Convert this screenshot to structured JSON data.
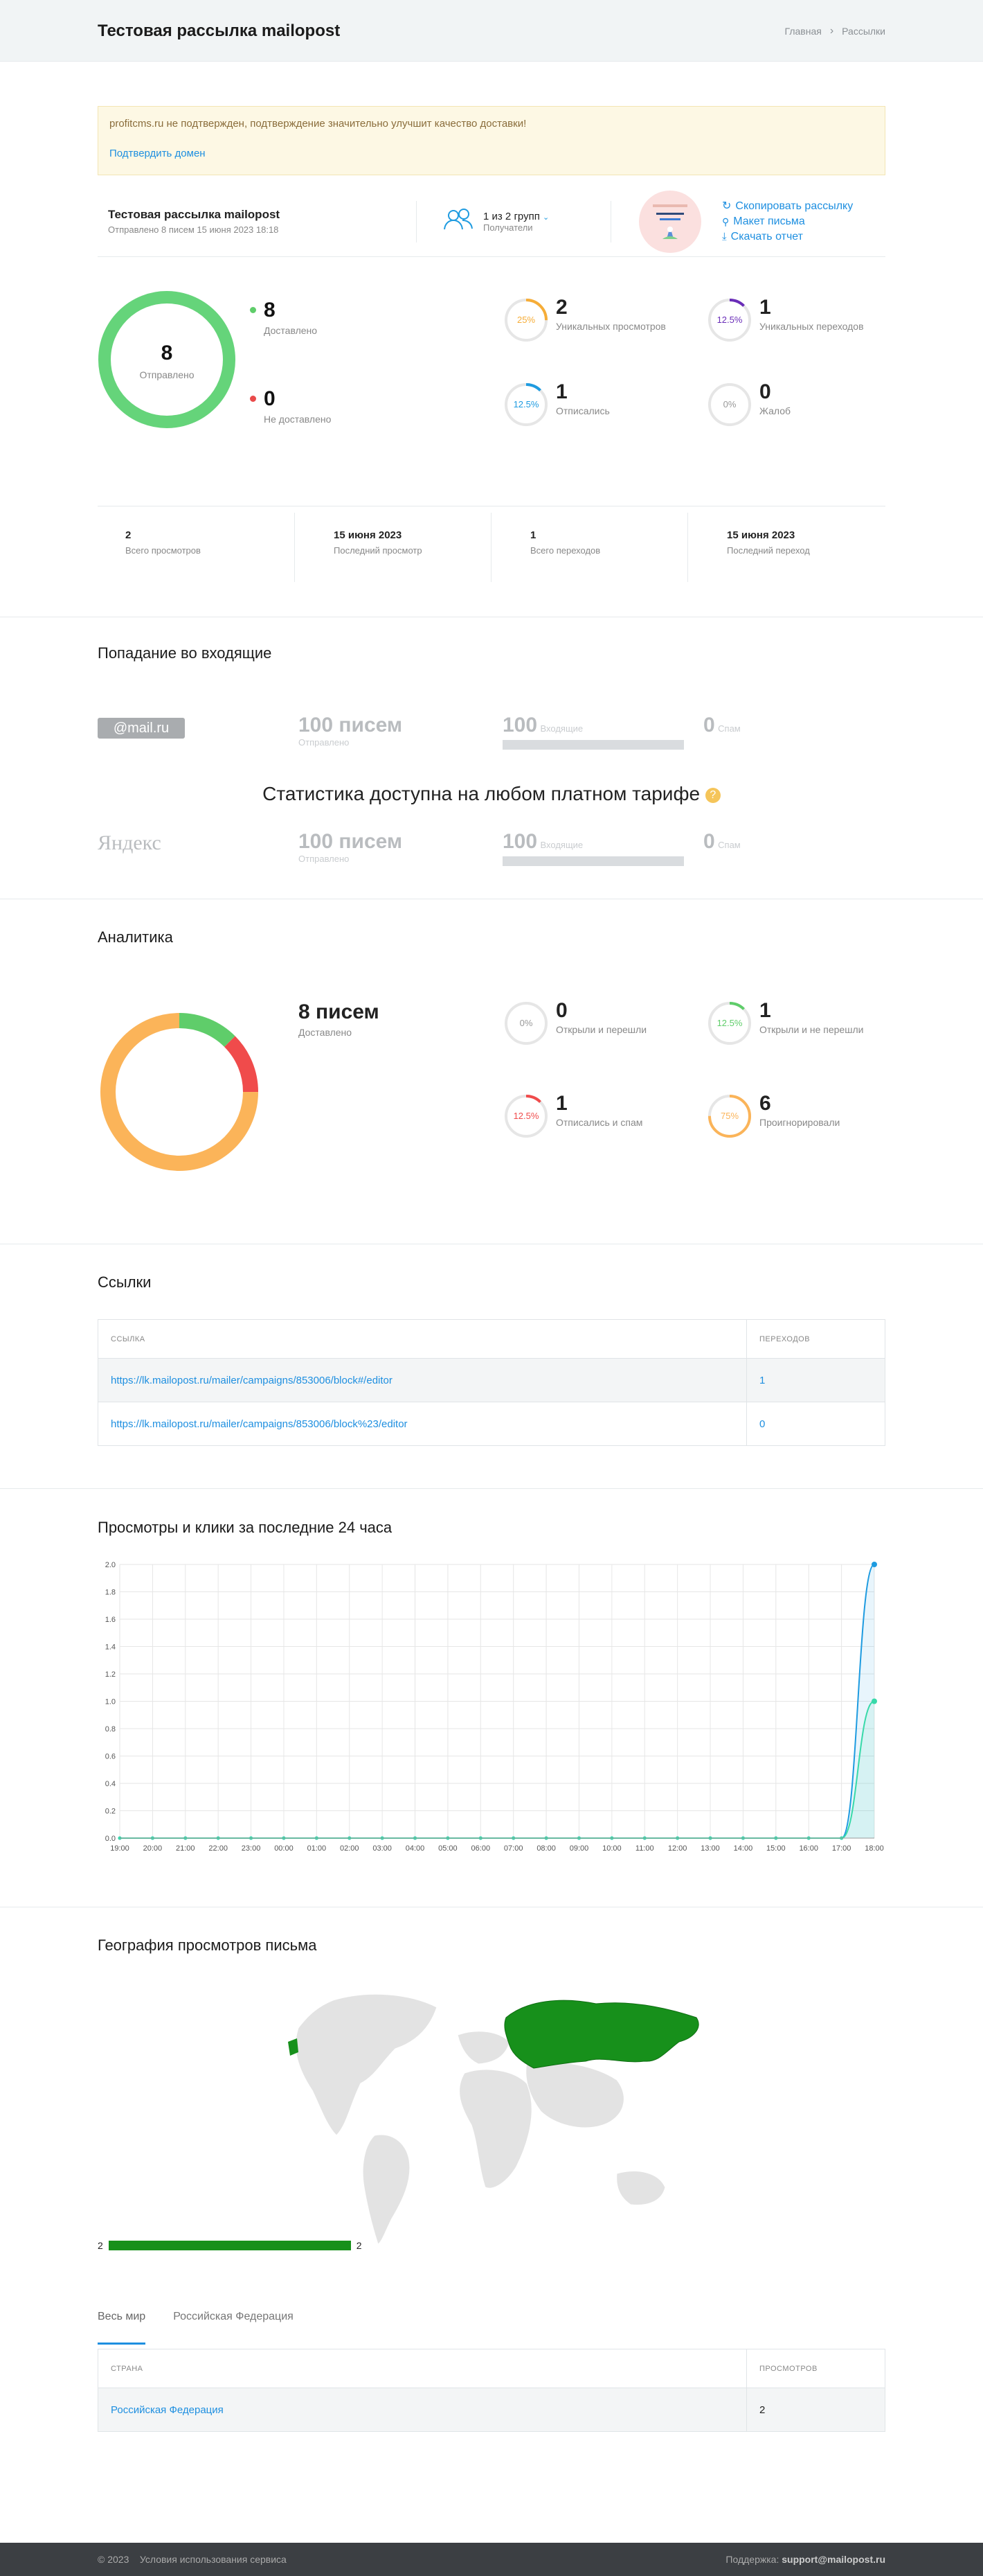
{
  "header": {
    "title": "Тестовая рассылка mailopost",
    "breadcrumbs": [
      "Главная",
      "Рассылки"
    ]
  },
  "alert": {
    "message": "profitcms.ru не подтвержден, подтверждение значительно улучшит качество доставки!",
    "link": "Подтвердить домен"
  },
  "campaign": {
    "name": "Тестовая рассылка mailopost",
    "sent_info": "Отправлено 8 писем 15 июня 2023 18:18",
    "recipients": "1 из 2 групп",
    "recipients_label": "Получатели",
    "actions": [
      "Скопировать рассылку",
      "Макет письма",
      "Скачать отчет"
    ]
  },
  "delivery": {
    "sent": "8",
    "sent_label": "Отправлено",
    "delivered": "8",
    "delivered_label": "Доставлено",
    "not_delivered": "0",
    "not_delivered_label": "Не доставлено",
    "delivered_fraction": 1.0
  },
  "metrics": [
    {
      "pct": "25%",
      "fraction": 0.25,
      "color": "#f6ad38",
      "value": "2",
      "label": "Уникальных просмотров"
    },
    {
      "pct": "12.5%",
      "fraction": 0.125,
      "color": "#6a2db8",
      "value": "1",
      "label": "Уникальных переходов"
    },
    {
      "pct": "12.5%",
      "fraction": 0.125,
      "color": "#1e9be0",
      "value": "1",
      "label": "Отписались"
    },
    {
      "pct": "0%",
      "fraction": 0,
      "color": "#e94a4a",
      "value": "0",
      "label": "Жалоб"
    }
  ],
  "totals": [
    {
      "value": "2",
      "label": "Всего просмотров"
    },
    {
      "value": "15 июня 2023",
      "label": "Последний просмотр"
    },
    {
      "value": "1",
      "label": "Всего переходов"
    },
    {
      "value": "15 июня 2023",
      "label": "Последний переход"
    }
  ],
  "inbox": {
    "title": "Попадание во входящие",
    "rows": [
      {
        "provider": "@mail.ru",
        "count": "100 писем",
        "count_label": "Отправлено",
        "inbox": "100",
        "inbox_label": "Входящие",
        "spam": "0",
        "spam_label": "Спам"
      },
      {
        "provider": "Яндекс",
        "count": "100 писем",
        "count_label": "Отправлено",
        "inbox": "100",
        "inbox_label": "Входящие",
        "spam": "0",
        "spam_label": "Спам"
      }
    ],
    "paywall": "Статистика доступна на любом платном тарифе"
  },
  "analytics": {
    "title": "Аналитика",
    "delivered": "8 писем",
    "delivered_label": "Доставлено",
    "donut": [
      {
        "fraction": 0.125,
        "color": "#5fcd6a"
      },
      {
        "fraction": 0.125,
        "color": "#f04b4b"
      },
      {
        "fraction": 0.75,
        "color": "#fbb459"
      }
    ],
    "items": [
      {
        "pct": "0%",
        "fraction": 0,
        "color": "#ccc",
        "value": "0",
        "label": "Открыли и перешли"
      },
      {
        "pct": "12.5%",
        "fraction": 0.125,
        "color": "#5fcd6a",
        "value": "1",
        "label": "Открыли и не перешли"
      },
      {
        "pct": "12.5%",
        "fraction": 0.125,
        "color": "#f04b4b",
        "value": "1",
        "label": "Отписались и спам"
      },
      {
        "pct": "75%",
        "fraction": 0.75,
        "color": "#fbb459",
        "value": "6",
        "label": "Проигнорировали"
      }
    ]
  },
  "links": {
    "title": "Ссылки",
    "col_link": "ССЫЛКА",
    "col_clicks": "ПЕРЕХОДОВ",
    "rows": [
      {
        "url": "https://lk.mailopost.ru/mailer/campaigns/853006/block#/editor",
        "clicks": "1"
      },
      {
        "url": "https://lk.mailopost.ru/mailer/campaigns/853006/block%23/editor",
        "clicks": "0"
      }
    ]
  },
  "chart_section": {
    "title": "Просмотры и клики за последние 24 часа"
  },
  "chart_data": {
    "type": "line",
    "x": [
      "19:00",
      "20:00",
      "21:00",
      "22:00",
      "23:00",
      "00:00",
      "01:00",
      "02:00",
      "03:00",
      "04:00",
      "05:00",
      "06:00",
      "07:00",
      "08:00",
      "09:00",
      "10:00",
      "11:00",
      "12:00",
      "13:00",
      "14:00",
      "15:00",
      "16:00",
      "17:00",
      "18:00"
    ],
    "series": [
      {
        "values": [
          0,
          0,
          0,
          0,
          0,
          0,
          0,
          0,
          0,
          0,
          0,
          0,
          0,
          0,
          0,
          0,
          0,
          0,
          0,
          0,
          0,
          0,
          0,
          2
        ],
        "color": "#1e9be0"
      },
      {
        "values": [
          0,
          0,
          0,
          0,
          0,
          0,
          0,
          0,
          0,
          0,
          0,
          0,
          0,
          0,
          0,
          0,
          0,
          0,
          0,
          0,
          0,
          0,
          0,
          1
        ],
        "color": "#38d9a9"
      }
    ],
    "ylim": [
      0,
      2
    ],
    "yticks": [
      "0.0",
      "0.2",
      "0.4",
      "0.6",
      "0.8",
      "1.0",
      "1.2",
      "1.4",
      "1.6",
      "1.8",
      "2.0"
    ],
    "grid": true
  },
  "geo": {
    "title": "География просмотров письма",
    "bar_left": "2",
    "bar_right": "2",
    "tabs": [
      "Весь мир",
      "Российская Федерация"
    ],
    "col_country": "СТРАНА",
    "col_views": "ПРОСМОТРОВ",
    "rows": [
      {
        "country": "Российская Федерация",
        "views": "2"
      }
    ]
  },
  "footer": {
    "copyright": "© 2023",
    "terms": "Условия использования сервиса",
    "support_label": "Поддержка:",
    "support_email": "support@mailopost.ru"
  }
}
